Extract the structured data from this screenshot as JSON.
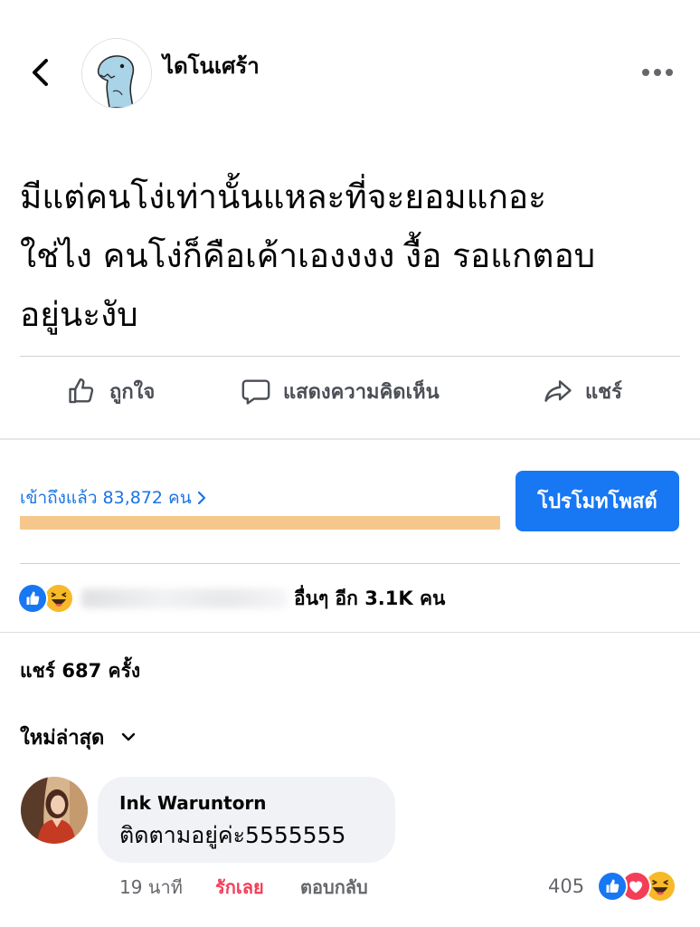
{
  "header": {
    "back_icon": "chevron-left-icon",
    "avatar": "dinosaur-avatar",
    "page_name": "ไดโนเศร้า",
    "more_icon": "more-dots-icon"
  },
  "post": {
    "text_lines": [
      "มีแต่คนโง่เท่านั้นแหละที่จะยอมแกอะ",
      "ใช่ไง คนโง่ก็คือเค้าเองงงง งื้อ รอแกตอบ",
      "อยู่นะงับ"
    ]
  },
  "actions": {
    "like_label": "ถูกใจ",
    "comment_label": "แสดงความคิดเห็น",
    "share_label": "แชร์"
  },
  "insights": {
    "reach_text": "เข้าถึงแล้ว 83,872 คน",
    "reach_bar_fill": 1,
    "reach_bar_color": "#f6c78c",
    "promote_label": "โปรโมทโพสต์"
  },
  "reactions": {
    "icons": [
      "like",
      "haha"
    ],
    "summary_text": "อื่นๆ อีก 3.1K คน"
  },
  "shares": {
    "text": "แชร์ 687 ครั้ง"
  },
  "comments": {
    "sort_label": "ใหม่ล่าสุด",
    "items": [
      {
        "author": "Ink Waruntorn",
        "text": "ติดตามอยู่ค่ะ5555555",
        "time": "19 นาที",
        "reaction_label": "รักเลย",
        "reply_label": "ตอบกลับ",
        "reaction_count": "405",
        "reaction_icons": [
          "like",
          "love",
          "haha"
        ]
      }
    ]
  },
  "colors": {
    "accent": "#1877f2",
    "love": "#f33e58",
    "haha": "#f7b928",
    "muted_text": "#65676b",
    "comment_bubble": "#f0f2f5"
  }
}
